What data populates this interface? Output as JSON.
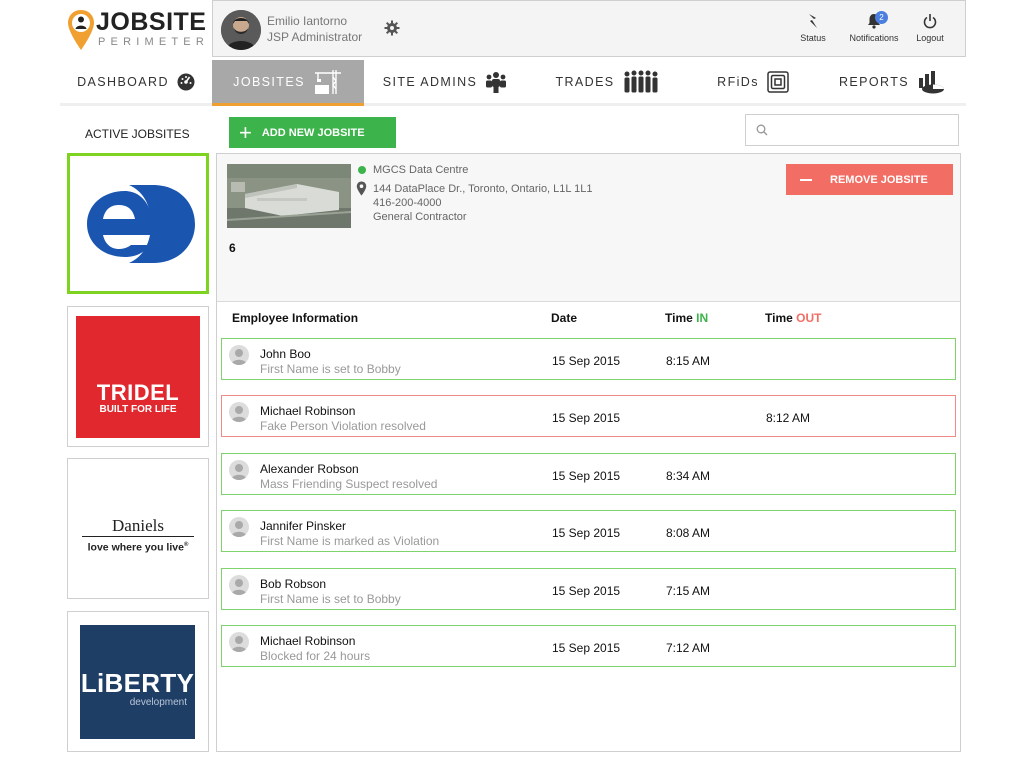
{
  "brand": {
    "name": "JOBSITE",
    "tagline": "PERIMETER",
    "accent": "#f0a030"
  },
  "user": {
    "name": "Emilio Iantorno",
    "role": "JSP Administrator"
  },
  "header_actions": [
    {
      "label": "Status",
      "icon": "status-icon"
    },
    {
      "label": "Notifications",
      "icon": "bell-icon",
      "badge": "2"
    },
    {
      "label": "Logout",
      "icon": "power-icon"
    }
  ],
  "nav": {
    "active": "JOBSITES",
    "items": [
      {
        "label": "DASHBOARD",
        "icon": "gauge-icon"
      },
      {
        "label": "JOBSITES",
        "icon": "crane-icon"
      },
      {
        "label": "SITE ADMINS",
        "icon": "admins-icon"
      },
      {
        "label": "TRADES",
        "icon": "workers-icon"
      },
      {
        "label": "RFiDs",
        "icon": "rfid-icon"
      },
      {
        "label": "REPORTS",
        "icon": "reports-icon"
      }
    ]
  },
  "toolbar": {
    "active_label": "ACTIVE JOBSITES",
    "add_label": "ADD NEW JOBSITE",
    "search_placeholder": ""
  },
  "jobsites": [
    {
      "logo": "eD",
      "selected": true
    },
    {
      "logo": "TRIDEL",
      "tagline": "BUILT FOR LIFE",
      "selected": false
    },
    {
      "logo": "Daniels",
      "tagline": "love where you live",
      "tm": "®",
      "selected": false
    },
    {
      "logo": "LiBERTY",
      "tagline": "development",
      "selected": false
    }
  ],
  "site": {
    "name": "MGCS Data Centre",
    "address": "144 DataPlace Dr., Toronto, Ontario, L1L 1L1",
    "phone": "416-200-4000",
    "type": "General Contractor",
    "count": "6",
    "remove_label": "REMOVE JOBSITE"
  },
  "table": {
    "headers": {
      "employee": "Employee Information",
      "date": "Date",
      "time_prefix": "Time",
      "in": "IN",
      "out": "OUT"
    },
    "rows": [
      {
        "name": "John Boo",
        "note": "First Name is set to Bobby",
        "date": "15 Sep 2015",
        "time_in": "8:15 AM",
        "time_out": "",
        "status": "ok"
      },
      {
        "name": "Michael Robinson",
        "note": "Fake Person Violation resolved",
        "date": "15 Sep 2015",
        "time_in": "",
        "time_out": "8:12 AM",
        "status": "violation"
      },
      {
        "name": "Alexander Robson",
        "note": "Mass Friending Suspect resolved",
        "date": "15 Sep 2015",
        "time_in": "8:34 AM",
        "time_out": "",
        "status": "ok"
      },
      {
        "name": "Jannifer Pinsker",
        "note": "First Name is marked as Violation",
        "date": "15 Sep 2015",
        "time_in": "8:08 AM",
        "time_out": "",
        "status": "ok"
      },
      {
        "name": "Bob Robson",
        "note": "First Name is set to Bobby",
        "date": "15 Sep 2015",
        "time_in": "7:15 AM",
        "time_out": "",
        "status": "ok"
      },
      {
        "name": "Michael Robinson",
        "note": "Blocked for 24 hours",
        "date": "15 Sep 2015",
        "time_in": "7:12 AM",
        "time_out": "",
        "status": "ok"
      }
    ]
  },
  "colors": {
    "green": "#3db34b",
    "red": "#f26d64",
    "selected_border": "#7ed321"
  }
}
